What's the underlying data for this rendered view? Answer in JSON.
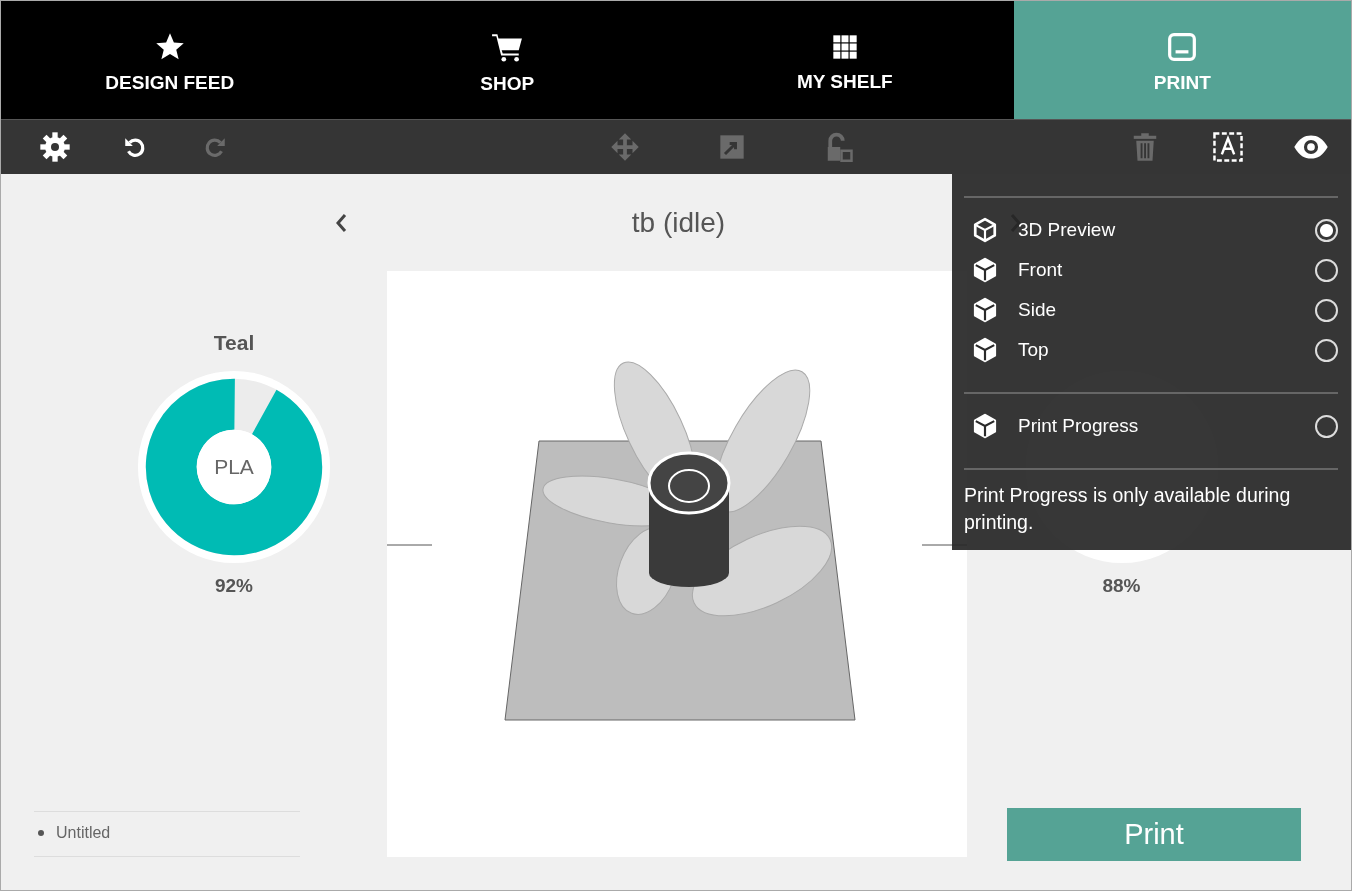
{
  "nav_tabs": [
    {
      "label": "DESIGN FEED",
      "selected": false
    },
    {
      "label": "SHOP",
      "selected": false
    },
    {
      "label": "MY SHELF",
      "selected": false
    },
    {
      "label": "PRINT",
      "selected": true
    }
  ],
  "toolbar": {
    "left": [
      {
        "disabled": false
      },
      {
        "disabled": false
      },
      {
        "disabled": true
      }
    ],
    "center": [
      {
        "disabled": true
      },
      {
        "disabled": true
      },
      {
        "disabled": true
      }
    ],
    "right": [
      {
        "disabled": true
      },
      {
        "disabled": false
      },
      {
        "disabled": false
      }
    ]
  },
  "printer_title": "tb (idle)",
  "filaments": [
    {
      "name": "Teal",
      "material": "PLA",
      "percent": "92%",
      "level": 0.92,
      "color": "#00bbb4"
    },
    {
      "percent": "88%"
    }
  ],
  "files": [
    {
      "name": "Untitled"
    }
  ],
  "print_button": "Print",
  "view_menu": {
    "views": [
      {
        "label": "3D Preview",
        "selected": true
      },
      {
        "label": "Front",
        "selected": false
      },
      {
        "label": "Side",
        "selected": false
      },
      {
        "label": "Top",
        "selected": false
      }
    ],
    "progress": [
      {
        "label": "Print Progress",
        "selected": false
      }
    ],
    "note": "Print Progress is only available during printing."
  }
}
